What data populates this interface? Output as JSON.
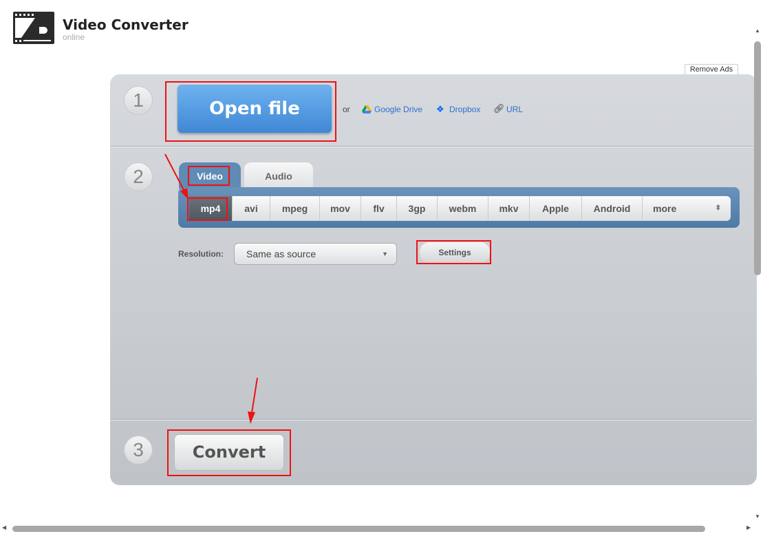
{
  "header": {
    "title": "Video Converter",
    "subtitle": "online",
    "remove_ads": "Remove Ads"
  },
  "step1": {
    "number": "1",
    "open_file": "Open file",
    "or": "or",
    "google_drive": "Google Drive",
    "dropbox": "Dropbox",
    "url": "URL"
  },
  "step2": {
    "number": "2",
    "tabs": [
      "Video",
      "Audio"
    ],
    "active_tab": "Video",
    "formats": [
      "mp4",
      "avi",
      "mpeg",
      "mov",
      "flv",
      "3gp",
      "webm",
      "mkv",
      "Apple",
      "Android",
      "more"
    ],
    "selected_format": "mp4",
    "resolution_label": "Resolution:",
    "resolution_value": "Same as source",
    "settings": "Settings"
  },
  "step3": {
    "number": "3",
    "convert": "Convert"
  },
  "colors": {
    "annotation": "#e11111",
    "open_file": "#4a92dd",
    "format_bar": "#5b86b0"
  }
}
